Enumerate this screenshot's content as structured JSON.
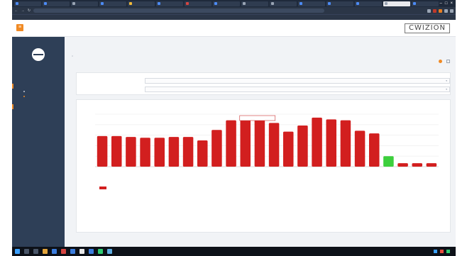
{
  "browser": {
    "tabs": [
      "",
      "",
      "",
      "",
      "",
      "",
      "",
      "",
      "",
      "",
      "",
      "",
      "",
      "",
      ""
    ],
    "active_tab_index": 13,
    "url": ""
  },
  "app": {
    "brand": "CWIZION",
    "sidebar": {
      "logo_text": "",
      "logo_sub": "",
      "menu": [
        {
          "label": "",
          "type": "head"
        },
        {
          "label": "",
          "type": "sub"
        },
        {
          "label": "",
          "type": "sub",
          "active": true
        },
        {
          "label": "",
          "type": "head"
        },
        {
          "label": "",
          "type": "item"
        },
        {
          "label": "",
          "type": "item"
        },
        {
          "label": "",
          "type": "item"
        },
        {
          "label": "",
          "type": "item"
        },
        {
          "label": "",
          "type": "item"
        },
        {
          "label": "",
          "type": "item"
        },
        {
          "label": "",
          "type": "item"
        },
        {
          "label": "",
          "type": "item"
        }
      ]
    },
    "page": {
      "title": "",
      "breadcrumb": "",
      "filters": [
        {
          "label": "",
          "value": ""
        },
        {
          "label": "",
          "value": ""
        }
      ]
    }
  },
  "chart_data": {
    "type": "bar",
    "title": "",
    "categories": [
      "",
      "",
      "",
      "",
      "",
      "",
      "",
      "",
      "",
      "",
      "",
      "",
      "",
      "",
      "",
      "",
      "",
      "",
      "",
      "",
      "",
      "",
      "",
      "",
      "",
      ""
    ],
    "series": [
      {
        "name": "",
        "values": [
          3.5,
          3.5,
          3.4,
          3.3,
          3.3,
          3.4,
          3.4,
          3.0,
          4.2,
          5.3,
          5.8,
          5.8,
          5.0,
          4.0,
          4.7,
          5.6,
          5.4,
          5.3,
          4.1,
          3.8,
          1.2,
          0.4,
          0.4,
          0.4
        ]
      }
    ],
    "highlight_index": 20,
    "tooltip": "",
    "ytick_labels": [
      "",
      "",
      "",
      "",
      "",
      ""
    ],
    "ylim": [
      0,
      6
    ],
    "grid": true,
    "legend": "bottom-left",
    "colors": {
      "bar": "#d21f1f",
      "highlight": "#3ccf3c"
    }
  },
  "taskbar": {
    "clock": ""
  }
}
